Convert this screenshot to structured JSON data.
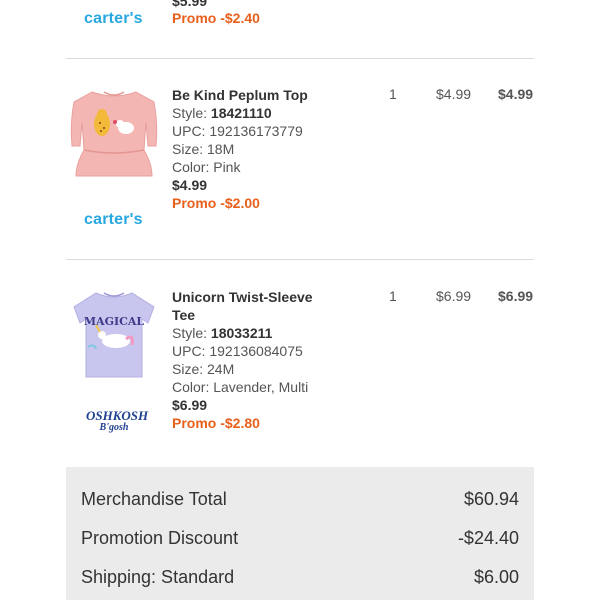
{
  "top_item": {
    "price_partial": "$5.99",
    "promo": "Promo -$2.40",
    "brand": "carter's"
  },
  "items": [
    {
      "name": "Be Kind Peplum Top",
      "style_label": "Style:",
      "style": "18421110",
      "upc": "UPC: 192136173779",
      "size": "Size: 18M",
      "color": "Color: Pink",
      "price": "$4.99",
      "promo": "Promo -$2.00",
      "qty": "1",
      "unit_price": "$4.99",
      "total": "$4.99",
      "brand": "carter's"
    },
    {
      "name_line1": "Unicorn Twist-Sleeve",
      "name_line2": "Tee",
      "style_label": "Style:",
      "style": "18033211",
      "upc": "UPC: 192136084075",
      "size": "Size: 24M",
      "color": "Color: Lavender, Multi",
      "price": "$6.99",
      "promo": "Promo -$2.80",
      "qty": "1",
      "unit_price": "$6.99",
      "total": "$6.99",
      "brand_line1": "OSHKOSH",
      "brand_line2": "B'gosh",
      "shirt_text": "MAGICAL"
    }
  ],
  "summary": {
    "merchandise_label": "Merchandise Total",
    "merchandise_value": "$60.94",
    "promotion_label": "Promotion Discount",
    "promotion_value": "-$24.40",
    "shipping_label": "Shipping: Standard",
    "shipping_value": "$6.00"
  },
  "colors": {
    "promo": "#e8601c",
    "carters_blue": "#27a8e0",
    "summary_bg": "#ebebeb"
  }
}
